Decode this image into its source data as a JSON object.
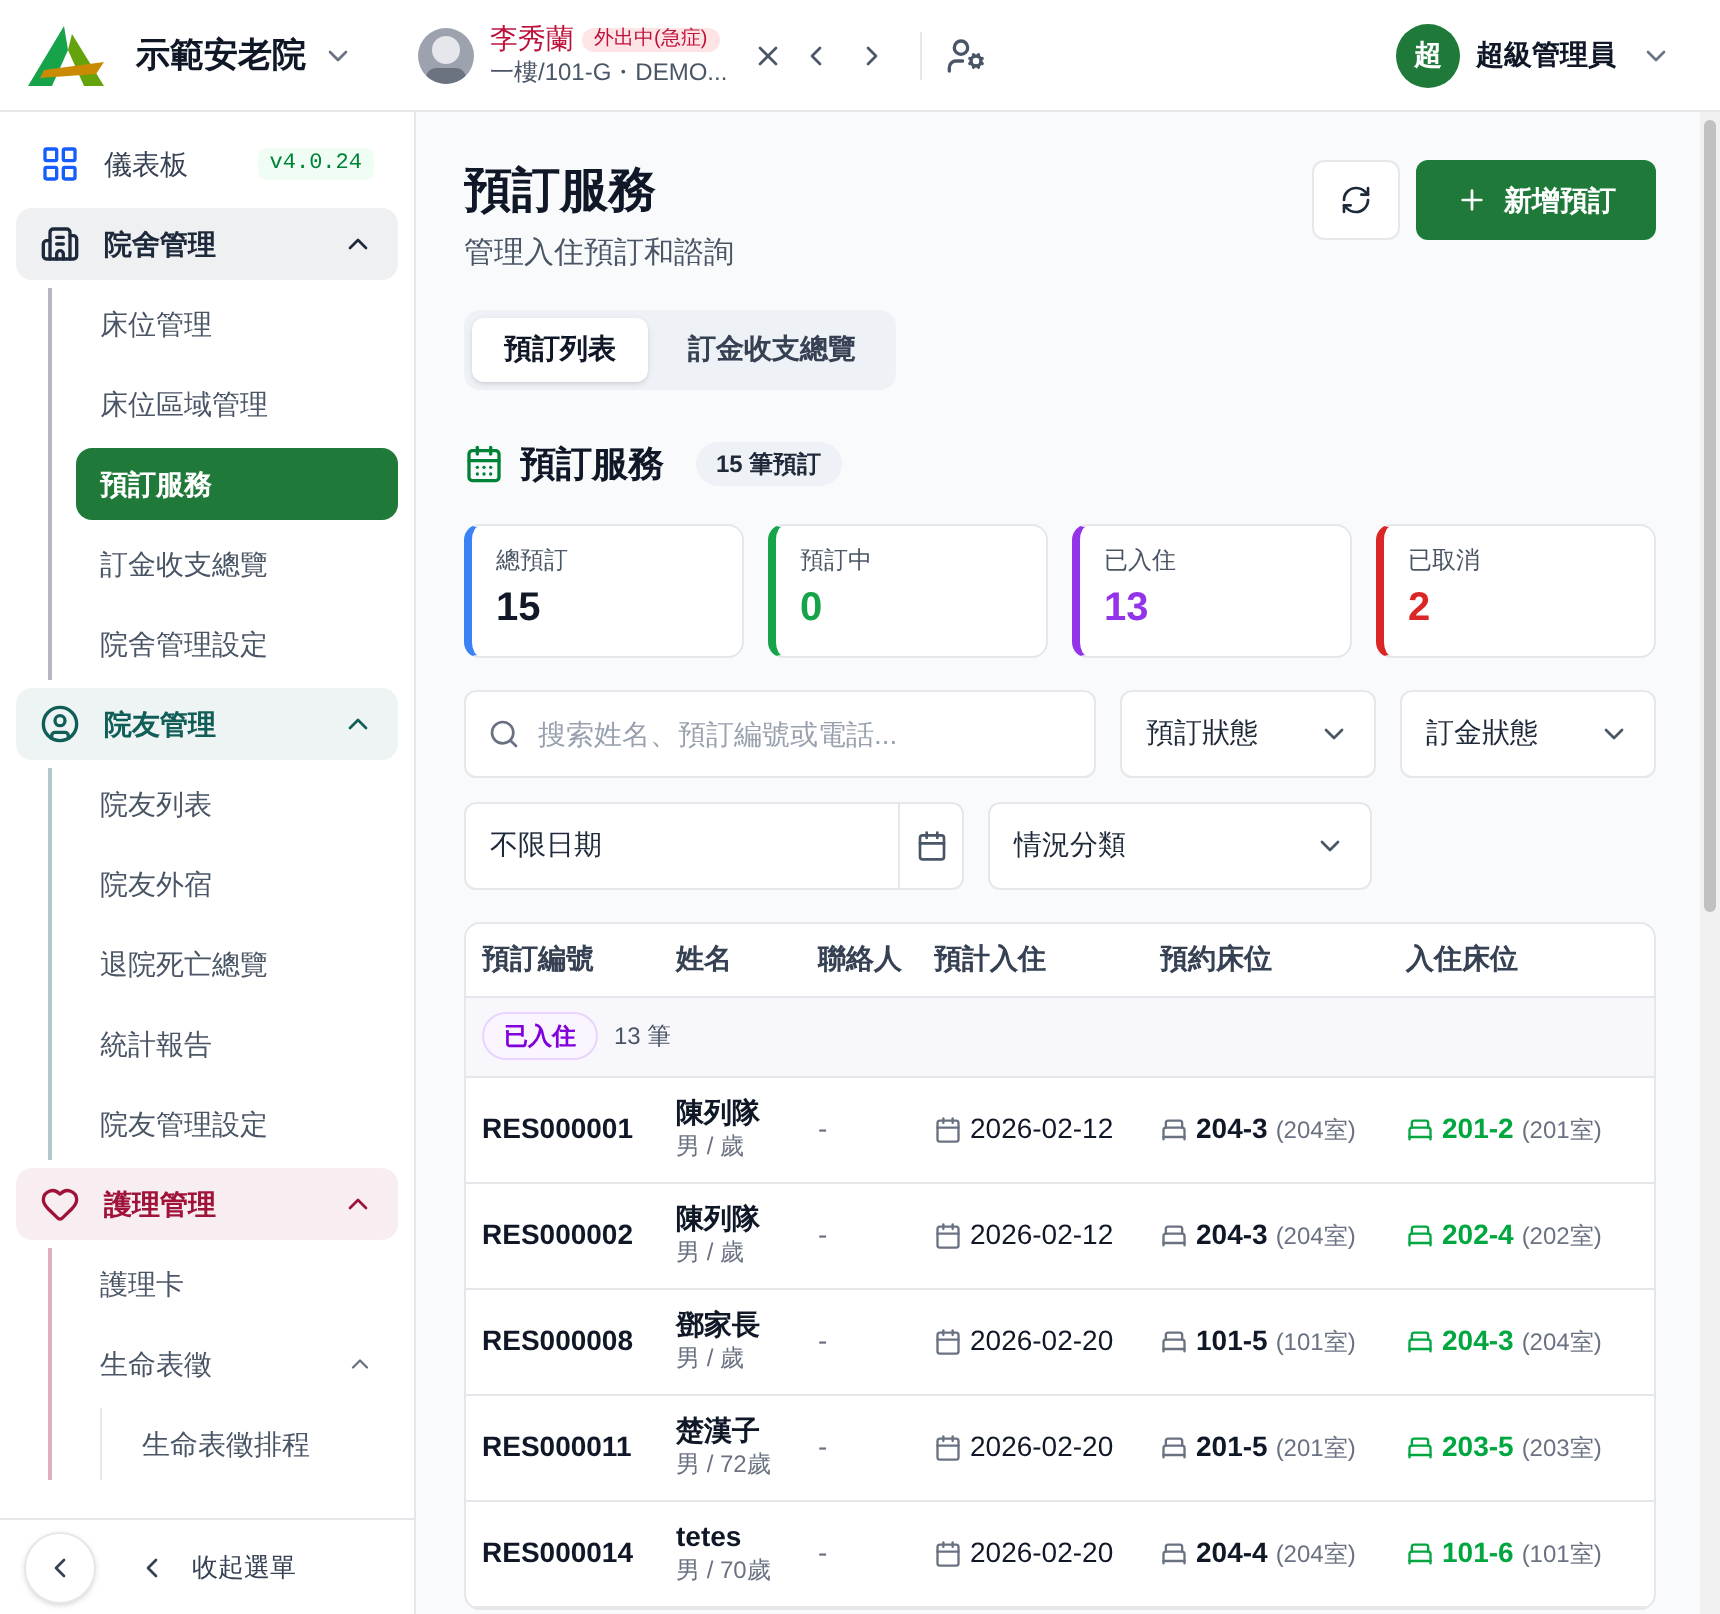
{
  "header": {
    "org_name": "示範安老院",
    "resident": {
      "name": "李秀蘭",
      "status": "外出中(急症)",
      "location": "一樓/101-G・DEMO..."
    },
    "user": {
      "initial": "超",
      "name": "超級管理員"
    }
  },
  "sidebar": {
    "items": [
      {
        "kind": "link",
        "label": "儀表板",
        "badge": "v4.0.24"
      },
      {
        "kind": "group",
        "label": "院舍管理",
        "color": "#1e293b",
        "expanded": true,
        "children": [
          {
            "label": "床位管理",
            "selected": false
          },
          {
            "label": "床位區域管理",
            "selected": false
          },
          {
            "label": "預訂服務",
            "selected": true
          },
          {
            "label": "訂金收支總覽",
            "selected": false
          },
          {
            "label": "院舍管理設定",
            "selected": false
          }
        ]
      },
      {
        "kind": "group",
        "label": "院友管理",
        "color": "#115e59",
        "expanded": true,
        "children": [
          {
            "label": "院友列表",
            "selected": false
          },
          {
            "label": "院友外宿",
            "selected": false
          },
          {
            "label": "退院死亡總覽",
            "selected": false
          },
          {
            "label": "統計報告",
            "selected": false
          },
          {
            "label": "院友管理設定",
            "selected": false
          }
        ]
      },
      {
        "kind": "group",
        "label": "護理管理",
        "color": "#9f1239",
        "expanded": true,
        "children": [
          {
            "label": "護理卡",
            "selected": false
          },
          {
            "label": "生命表徵",
            "selected": false,
            "expanded": true,
            "children": [
              {
                "label": "生命表徵排程",
                "selected": false
              }
            ]
          }
        ]
      }
    ],
    "collapse_label": "收起選單"
  },
  "page": {
    "title": "預訂服務",
    "subtitle": "管理入住預訂和諮詢",
    "new_button": "新增預訂",
    "tabs": [
      {
        "label": "預訂列表",
        "selected": true
      },
      {
        "label": "訂金收支總覽",
        "selected": false
      }
    ],
    "section": {
      "title": "預訂服務",
      "count": "15 筆預訂"
    },
    "stats": [
      {
        "kind": "total",
        "label": "總預訂",
        "value": "15",
        "color": "#3b82f6"
      },
      {
        "kind": "status",
        "label": "預訂中",
        "value": "0",
        "color": "#16a34a"
      },
      {
        "kind": "status",
        "label": "已入住",
        "value": "13",
        "color": "#9333ea"
      },
      {
        "kind": "status",
        "label": "已取消",
        "value": "2",
        "color": "#dc2626"
      }
    ],
    "filters": {
      "search_placeholder": "搜索姓名、預訂編號或電話...",
      "booking_status": "預訂狀態",
      "deposit_status": "訂金狀態",
      "date": "不限日期",
      "category": "情況分類"
    },
    "table": {
      "columns": [
        "預訂編號",
        "姓名",
        "聯絡人",
        "預計入住",
        "預約床位",
        "入住床位"
      ],
      "group": {
        "label": "已入住",
        "count": "13 筆"
      },
      "rows": [
        {
          "id": "RES000001",
          "name": "陳列隊",
          "info": "男 / 歲",
          "contact": "-",
          "date": "2026-02-12",
          "booked_bed": "204-3",
          "booked_room": "(204室)",
          "bed": "201-2",
          "room": "(201室)"
        },
        {
          "id": "RES000002",
          "name": "陳列隊",
          "info": "男 / 歲",
          "contact": "-",
          "date": "2026-02-12",
          "booked_bed": "204-3",
          "booked_room": "(204室)",
          "bed": "202-4",
          "room": "(202室)"
        },
        {
          "id": "RES000008",
          "name": "鄧家長",
          "info": "男 / 歲",
          "contact": "-",
          "date": "2026-02-20",
          "booked_bed": "101-5",
          "booked_room": "(101室)",
          "bed": "204-3",
          "room": "(204室)"
        },
        {
          "id": "RES000011",
          "name": "楚漢子",
          "info": "男 / 72歲",
          "contact": "-",
          "date": "2026-02-20",
          "booked_bed": "201-5",
          "booked_room": "(201室)",
          "bed": "203-5",
          "room": "(203室)"
        },
        {
          "id": "RES000014",
          "name": "tetes",
          "info": "男 / 70歲",
          "contact": "-",
          "date": "2026-02-20",
          "booked_bed": "204-4",
          "booked_room": "(204室)",
          "bed": "101-6",
          "room": "(101室)"
        }
      ]
    }
  }
}
